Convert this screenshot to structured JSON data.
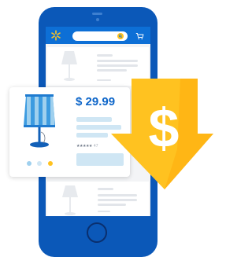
{
  "screen": {
    "list_rows": [
      {
        "count": ""
      },
      {
        "count": ""
      }
    ]
  },
  "product_card": {
    "price": "$ 29.99",
    "rating_count": "47",
    "swatches": [
      "#9fd0ee",
      "#cfe6f4",
      "#ffc220"
    ]
  },
  "price_drop": {
    "symbol": "$"
  },
  "colors": {
    "phone": "#0b58b8",
    "appbar": "#0d6fd6",
    "accent_yellow": "#ffc220",
    "price_blue": "#0e66c9"
  },
  "icons": [
    "spark-logo-icon",
    "search-icon",
    "cart-icon",
    "lamp-icon",
    "dollar-icon",
    "arrow-down-icon"
  ]
}
